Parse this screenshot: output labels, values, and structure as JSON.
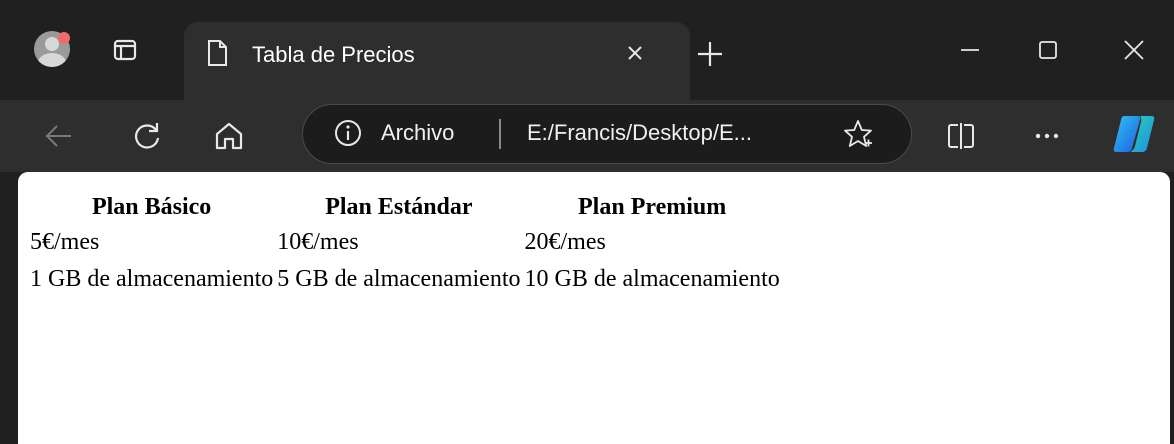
{
  "tab": {
    "title": "Tabla de Precios"
  },
  "address_bar": {
    "scheme_label": "Archivo",
    "url": "E:/Francis/Desktop/E..."
  },
  "icons": {
    "profile": "avatar-icon",
    "tab_actions": "tab-actions-icon",
    "page": "page-icon",
    "close_tab": "close-icon",
    "new_tab": "plus-icon",
    "minimize": "minimize-icon",
    "maximize": "maximize-icon",
    "close_window": "close-icon",
    "back": "back-arrow-icon",
    "refresh": "refresh-icon",
    "home": "home-icon",
    "info": "info-icon",
    "favorite": "star-icon",
    "split_screen": "split-screen-icon",
    "more": "more-icon",
    "copilot": "copilot-icon"
  },
  "pricing_table": {
    "headers": [
      "Plan Básico",
      "Plan Estándar",
      "Plan Premium"
    ],
    "rows": [
      [
        "5€/mes",
        "10€/mes",
        "20€/mes"
      ],
      [
        "1 GB de almacenamiento",
        "5 GB de almacenamiento",
        "10 GB de almacenamiento"
      ]
    ]
  },
  "colors": {
    "chrome_dark": "#202020",
    "toolbar": "#2e2e2e",
    "notification_dot": "#f16a6a",
    "page_background": "#ffffff"
  }
}
